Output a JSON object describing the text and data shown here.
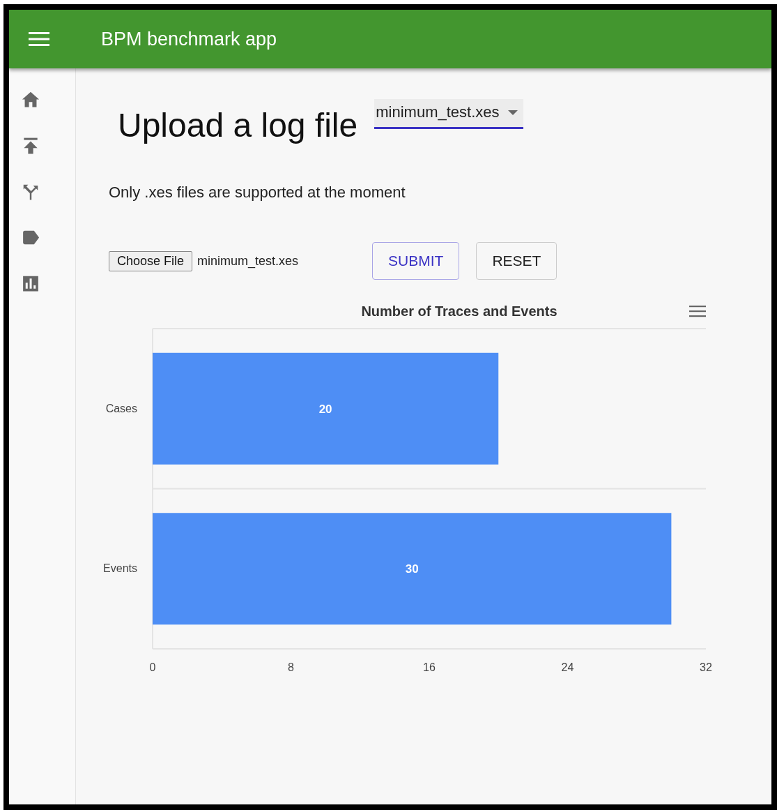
{
  "app_bar": {
    "title": "BPM benchmark app"
  },
  "sidebar": {
    "items": [
      {
        "kind": "home"
      },
      {
        "kind": "upload"
      },
      {
        "kind": "merge"
      },
      {
        "kind": "label"
      },
      {
        "kind": "chart"
      }
    ]
  },
  "page": {
    "heading": "Upload a log file",
    "log_select": {
      "value": "minimum_test.xes"
    },
    "note": "Only .xes files are supported at the moment",
    "file_input": {
      "button": "Choose File",
      "file_name": "minimum_test.xes"
    },
    "buttons": [
      {
        "label": "SUBMIT",
        "kind": "primary"
      },
      {
        "label": "RESET",
        "kind": "default"
      }
    ]
  },
  "chart": {
    "chart_data": {
      "type": "bar",
      "orientation": "horizontal",
      "title": "Number of Traces and Events",
      "categories": [
        "Cases",
        "Events"
      ],
      "series": [
        {
          "color": "#4e8ef5",
          "values": [
            20,
            30
          ]
        }
      ],
      "xlim": [
        0,
        32
      ],
      "xticks": [
        0,
        8,
        16,
        24,
        32
      ],
      "data_labels": true
    }
  }
}
